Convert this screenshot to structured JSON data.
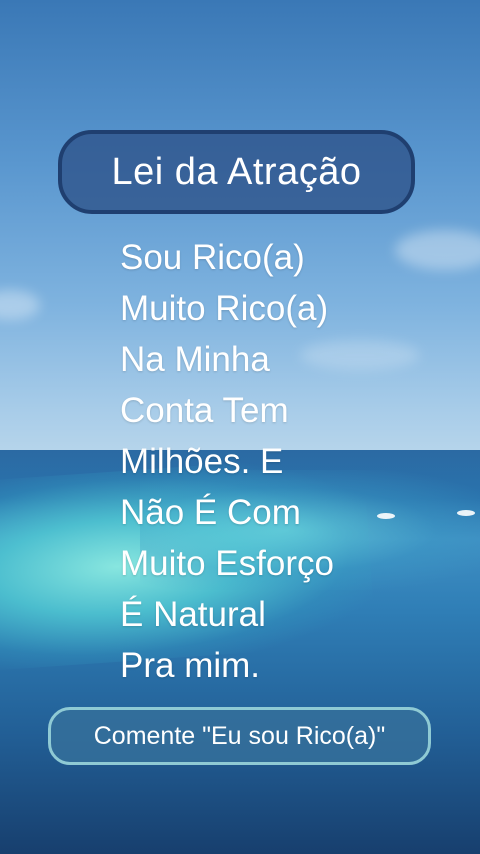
{
  "title": "Lei da Atração",
  "affirmation_lines": [
    "Sou Rico(a)",
    "Muito Rico(a)",
    "Na Minha",
    "Conta Tem",
    "Milhões. E",
    "Não É Com",
    "Muito Esforço",
    "É Natural",
    "Pra mim."
  ],
  "cta_label": "Comente \"Eu sou Rico(a)\"",
  "background": {
    "subject": "ocean-horizon-with-turquoise-lagoon"
  },
  "colors": {
    "title_pill_fill": "#30568c",
    "title_pill_border": "#1f3f70",
    "cta_fill": "#36709b",
    "cta_border": "#8fcad4",
    "text": "#ffffff"
  }
}
